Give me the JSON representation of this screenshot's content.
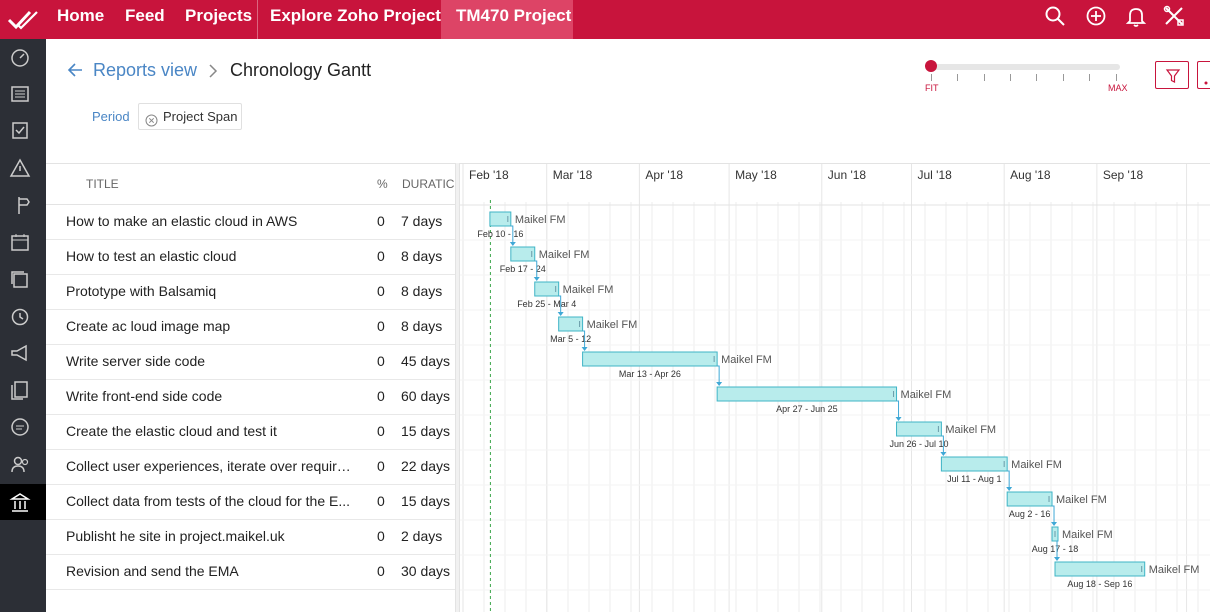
{
  "topbar": {
    "nav": [
      "Home",
      "Feed",
      "Projects",
      "Explore Zoho Projects!",
      "TM470 Project"
    ]
  },
  "breadcrumb": {
    "parent": "Reports view",
    "title": "Chronology Gantt"
  },
  "period": {
    "label": "Period",
    "value": "Project Span"
  },
  "zoom": {
    "min_label": "FIT",
    "max_label": "MAX",
    "level": 0
  },
  "table": {
    "headers": {
      "title": "TITLE",
      "pct": "%",
      "duration": "DURATIC"
    },
    "rows": [
      {
        "title": "How to make an elastic cloud in AWS",
        "pct": "0",
        "duration": "7 days"
      },
      {
        "title": "How to test an elastic cloud",
        "pct": "0",
        "duration": "8 days"
      },
      {
        "title": "Prototype with Balsamiq",
        "pct": "0",
        "duration": "8 days"
      },
      {
        "title": "Create ac loud image map",
        "pct": "0",
        "duration": "8 days"
      },
      {
        "title": "Write server side code",
        "pct": "0",
        "duration": "45 days"
      },
      {
        "title": "Write front-end side code",
        "pct": "0",
        "duration": "60 days"
      },
      {
        "title": "Create the elastic cloud and test it",
        "pct": "0",
        "duration": "15 days"
      },
      {
        "title": "Collect user experiences, iterate over require...",
        "pct": "0",
        "duration": "22 days"
      },
      {
        "title": "Collect data from tests of the cloud for the E...",
        "pct": "0",
        "duration": "15 days"
      },
      {
        "title": "Publisht he site in project.maikel.uk",
        "pct": "0",
        "duration": "2 days"
      },
      {
        "title": "Revision and send the EMA",
        "pct": "0",
        "duration": "30 days"
      }
    ]
  },
  "gantt": {
    "year": 2018,
    "months": [
      "Feb '18",
      "Mar '18",
      "Apr '18",
      "May '18",
      "Jun '18",
      "Jul '18",
      "Aug '18",
      "Sep '18"
    ],
    "colors": {
      "bar_fill": "#b8ecec",
      "bar_stroke": "#3fb4c6",
      "arrow": "#3fa8d6",
      "today_line": "#3aa64a"
    },
    "tasks": [
      {
        "start": "2018-02-10",
        "end": "2018-02-16",
        "owner": "Maikel FM",
        "date_label": "Feb 10 - 16"
      },
      {
        "start": "2018-02-17",
        "end": "2018-02-24",
        "owner": "Maikel FM",
        "date_label": "Feb 17 - 24"
      },
      {
        "start": "2018-02-25",
        "end": "2018-03-04",
        "owner": "Maikel FM",
        "date_label": "Feb 25 - Mar 4"
      },
      {
        "start": "2018-03-05",
        "end": "2018-03-12",
        "owner": "Maikel FM",
        "date_label": "Mar 5 - 12"
      },
      {
        "start": "2018-03-13",
        "end": "2018-04-26",
        "owner": "Maikel FM",
        "date_label": "Mar 13 - Apr 26"
      },
      {
        "start": "2018-04-27",
        "end": "2018-06-25",
        "owner": "Maikel FM",
        "date_label": "Apr 27 - Jun 25"
      },
      {
        "start": "2018-06-26",
        "end": "2018-07-10",
        "owner": "Maikel FM",
        "date_label": "Jun 26 - Jul 10"
      },
      {
        "start": "2018-07-11",
        "end": "2018-08-01",
        "owner": "Maikel FM",
        "date_label": "Jul 11 - Aug 1"
      },
      {
        "start": "2018-08-02",
        "end": "2018-08-16",
        "owner": "Maikel FM",
        "date_label": "Aug 2 - 16"
      },
      {
        "start": "2018-08-17",
        "end": "2018-08-18",
        "owner": "Maikel FM",
        "date_label": "Aug 17 - 18"
      },
      {
        "start": "2018-08-18",
        "end": "2018-09-16",
        "owner": "Maikel FM",
        "date_label": "Aug 18 - Sep 16"
      }
    ]
  }
}
